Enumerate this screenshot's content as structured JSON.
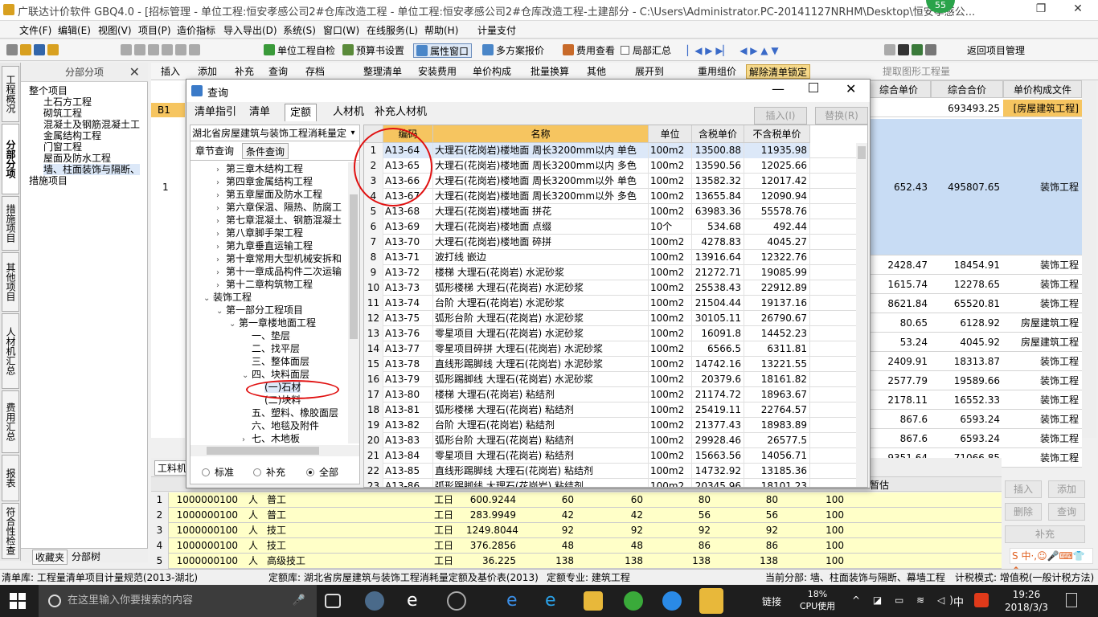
{
  "titlebar": {
    "title": "广联达计价软件 GBQ4.0 - [招标管理 - 单位工程:恒安孝感公司2#仓库改造工程 - 单位工程:恒安孝感公司2#仓库改造工程-土建部分 - C:\\Users\\Administrator.PC-20141127NRHM\\Desktop\\恒安孝感公...",
    "badge": "55",
    "restore": "❐",
    "close": "✕"
  },
  "menu": {
    "items": [
      "文件(F)",
      "编辑(E)",
      "视图(V)",
      "项目(P)",
      "造价指标",
      "导入导出(D)",
      "系统(S)",
      "窗口(W)",
      "在线服务(L)",
      "帮助(H)",
      "计量支付"
    ]
  },
  "toolbar1": {
    "unit_check": "单位工程自检",
    "budget_settings": "预算书设置",
    "attr_window": "属性窗口",
    "multi_quote": "多方案报价",
    "fee_view": "费用查看",
    "partial_summary": "局部汇总",
    "return_project": "返回项目管理"
  },
  "toolbar2": {
    "items": [
      "插入",
      "添加",
      "补充",
      "查询",
      "存档",
      "整理清单",
      "安装费用",
      "单价构成",
      "批量换算",
      "其他",
      "展开到",
      "重用组价",
      "解除清单锁定",
      "提取图形工程量"
    ]
  },
  "vtabs": [
    "工程概况",
    "分部分项",
    "措施项目",
    "其他项目",
    "人材机汇总",
    "费用汇总",
    "报表",
    "符合性检查"
  ],
  "leftpanel": {
    "header": "分部分项",
    "close": "✕",
    "items": [
      "整个项目",
      "土石方工程",
      "砌筑工程",
      "混凝土及钢筋混凝土工",
      "金属结构工程",
      "门窗工程",
      "屋面及防水工程",
      "墙、柱面装饰与隔断、",
      "措施项目"
    ],
    "bottom_tabs": [
      "收藏夹",
      "分部树"
    ]
  },
  "main_grid": {
    "headers": [
      "综合单价",
      "综合合价",
      "单价构成文件"
    ],
    "b1": "B1",
    "row1_num": "1",
    "rows": [
      [
        "",
        "693493.25",
        "[房屋建筑工程]"
      ],
      [
        "652.43",
        "495807.65",
        "装饰工程"
      ],
      [
        "2428.47",
        "18454.91",
        "装饰工程"
      ],
      [
        "1615.74",
        "12278.65",
        "装饰工程"
      ],
      [
        "8621.84",
        "65520.81",
        "装饰工程"
      ],
      [
        "80.65",
        "6128.92",
        "房屋建筑工程"
      ],
      [
        "53.24",
        "4045.92",
        "房屋建筑工程"
      ],
      [
        "2409.91",
        "18313.87",
        "装饰工程"
      ],
      [
        "2577.79",
        "19589.66",
        "装饰工程"
      ],
      [
        "2178.11",
        "16552.33",
        "装饰工程"
      ],
      [
        "867.6",
        "6593.24",
        "装饰工程"
      ],
      [
        "867.6",
        "6593.24",
        "装饰工程"
      ],
      [
        "9351.64",
        "71066.85",
        "装饰工程"
      ]
    ]
  },
  "bottom_grid": {
    "tab": "工料机",
    "temp_label": "暂估",
    "rows": [
      [
        "1",
        "1000000100",
        "人",
        "普工",
        "工日",
        "600.9244",
        "60",
        "60",
        "80",
        "80",
        "100"
      ],
      [
        "2",
        "1000000100",
        "人",
        "普工",
        "工日",
        "283.9949",
        "42",
        "42",
        "56",
        "56",
        "100"
      ],
      [
        "3",
        "1000000100",
        "人",
        "技工",
        "工日",
        "1249.8044",
        "92",
        "92",
        "92",
        "92",
        "100"
      ],
      [
        "4",
        "1000000100",
        "人",
        "技工",
        "工日",
        "376.2856",
        "48",
        "48",
        "86",
        "86",
        "100"
      ],
      [
        "5",
        "1000000100",
        "人",
        "高级技工",
        "工日",
        "36.225",
        "138",
        "138",
        "138",
        "138",
        "100"
      ]
    ],
    "buttons": [
      "插入",
      "添加",
      "删除",
      "查询",
      "补充"
    ]
  },
  "dialog": {
    "title": "查询",
    "tabs": [
      "清单指引",
      "清单",
      "定额",
      "人材机",
      "补充人材机"
    ],
    "insert": "插入(I)",
    "replace": "替换(R)",
    "quota_lib": "湖北省房屋建筑与装饰工程消耗量定",
    "subtabs": [
      "章节查询",
      "条件查询"
    ],
    "tree": [
      {
        "t": "第三章木结构工程",
        "l": 1,
        "a": "›"
      },
      {
        "t": "第四章金属结构工程",
        "l": 1,
        "a": "›"
      },
      {
        "t": "第五章屋面及防水工程",
        "l": 1,
        "a": "›"
      },
      {
        "t": "第六章保温、隔热、防腐工",
        "l": 1,
        "a": "›"
      },
      {
        "t": "第七章混凝土、钢筋混凝土",
        "l": 1,
        "a": "›"
      },
      {
        "t": "第八章脚手架工程",
        "l": 1,
        "a": "›"
      },
      {
        "t": "第九章垂直运输工程",
        "l": 1,
        "a": "›"
      },
      {
        "t": "第十章常用大型机械安拆和",
        "l": 1,
        "a": "›"
      },
      {
        "t": "第十一章成品构件二次运输",
        "l": 1,
        "a": "›"
      },
      {
        "t": "第十二章构筑物工程",
        "l": 1,
        "a": "›"
      },
      {
        "t": "装饰工程",
        "l": 0,
        "a": "⌄"
      },
      {
        "t": "第一部分工程项目",
        "l": 1,
        "a": "⌄"
      },
      {
        "t": "第一章楼地面工程",
        "l": 2,
        "a": "⌄"
      },
      {
        "t": "一、垫层",
        "l": 3,
        "a": ""
      },
      {
        "t": "二、找平层",
        "l": 3,
        "a": ""
      },
      {
        "t": "三、整体面层",
        "l": 3,
        "a": ""
      },
      {
        "t": "四、块料面层",
        "l": 3,
        "a": "⌄"
      },
      {
        "t": "(一)石材",
        "l": 4,
        "a": ""
      },
      {
        "t": "(二)块料",
        "l": 4,
        "a": ""
      },
      {
        "t": "五、塑料、橡胶面层",
        "l": 3,
        "a": ""
      },
      {
        "t": "六、地毯及附件",
        "l": 3,
        "a": ""
      },
      {
        "t": "七、木地板",
        "l": 3,
        "a": "›"
      }
    ],
    "radios": [
      "标准",
      "补充",
      "全部"
    ],
    "columns": [
      "编码",
      "名称",
      "单位",
      "含税单价",
      "不含税单价"
    ],
    "rows": [
      [
        "1",
        "A13-64",
        "大理石(花岗岩)楼地面 周长3200mm以内 单色",
        "100m2",
        "13500.88",
        "11935.98"
      ],
      [
        "2",
        "A13-65",
        "大理石(花岗岩)楼地面 周长3200mm以内 多色",
        "100m2",
        "13590.56",
        "12025.66"
      ],
      [
        "3",
        "A13-66",
        "大理石(花岗岩)楼地面 周长3200mm以外 单色",
        "100m2",
        "13582.32",
        "12017.42"
      ],
      [
        "4",
        "A13-67",
        "大理石(花岗岩)楼地面 周长3200mm以外 多色",
        "100m2",
        "13655.84",
        "12090.94"
      ],
      [
        "5",
        "A13-68",
        "大理石(花岗岩)楼地面 拼花",
        "100m2",
        "63983.36",
        "55578.76"
      ],
      [
        "6",
        "A13-69",
        "大理石(花岗岩)楼地面 点缀",
        "10个",
        "534.68",
        "492.44"
      ],
      [
        "7",
        "A13-70",
        "大理石(花岗岩)楼地面 碎拼",
        "100m2",
        "4278.83",
        "4045.27"
      ],
      [
        "8",
        "A13-71",
        "波打线 嵌边",
        "100m2",
        "13916.64",
        "12322.76"
      ],
      [
        "9",
        "A13-72",
        "楼梯 大理石(花岗岩) 水泥砂浆",
        "100m2",
        "21272.71",
        "19085.99"
      ],
      [
        "10",
        "A13-73",
        "弧形楼梯 大理石(花岗岩) 水泥砂浆",
        "100m2",
        "25538.43",
        "22912.89"
      ],
      [
        "11",
        "A13-74",
        "台阶 大理石(花岗岩) 水泥砂浆",
        "100m2",
        "21504.44",
        "19137.16"
      ],
      [
        "12",
        "A13-75",
        "弧形台阶 大理石(花岗岩) 水泥砂浆",
        "100m2",
        "30105.11",
        "26790.67"
      ],
      [
        "13",
        "A13-76",
        "零星项目 大理石(花岗岩) 水泥砂浆",
        "100m2",
        "16091.8",
        "14452.23"
      ],
      [
        "14",
        "A13-77",
        "零星项目碎拼 大理石(花岗岩) 水泥砂浆",
        "100m2",
        "6566.5",
        "6311.81"
      ],
      [
        "15",
        "A13-78",
        "直线形踢脚线 大理石(花岗岩) 水泥砂浆",
        "100m2",
        "14742.16",
        "13221.55"
      ],
      [
        "16",
        "A13-79",
        "弧形踢脚线 大理石(花岗岩) 水泥砂浆",
        "100m2",
        "20379.6",
        "18161.82"
      ],
      [
        "17",
        "A13-80",
        "楼梯 大理石(花岗岩) 粘结剂",
        "100m2",
        "21174.72",
        "18963.67"
      ],
      [
        "18",
        "A13-81",
        "弧形楼梯 大理石(花岗岩) 粘结剂",
        "100m2",
        "25419.11",
        "22764.57"
      ],
      [
        "19",
        "A13-82",
        "台阶 大理石(花岗岩) 粘结剂",
        "100m2",
        "21377.43",
        "18983.89"
      ],
      [
        "20",
        "A13-83",
        "弧形台阶 大理石(花岗岩) 粘结剂",
        "100m2",
        "29928.46",
        "26577.5"
      ],
      [
        "21",
        "A13-84",
        "零星项目 大理石(花岗岩) 粘结剂",
        "100m2",
        "15663.56",
        "14056.71"
      ],
      [
        "22",
        "A13-85",
        "直线形踢脚线 大理石(花岗岩) 粘结剂",
        "100m2",
        "14732.92",
        "13185.36"
      ],
      [
        "23",
        "A13-86",
        "弧形踢脚线 大理石(花岗岩) 粘结剂",
        "100m2",
        "20345.96",
        "18101.23"
      ]
    ]
  },
  "status": {
    "list_lib": "清单库: 工程量清单项目计量规范(2013-湖北)",
    "quota_lib": "定额库: 湖北省房屋建筑与装饰工程消耗量定额及基价表(2013)",
    "quota_major": "定额专业: 建筑工程",
    "current": "当前分部: 墙、柱面装饰与隔断、幕墙工程",
    "tax_mode": "计税模式: 增值税(一般计税方法)"
  },
  "taskbar": {
    "search_placeholder": "在这里输入你要搜索的内容",
    "link": "链接",
    "cpu_pct": "18%",
    "cpu_label": "CPU使用",
    "ime": "中",
    "time": "19:26",
    "date": "2018/3/3"
  },
  "colors": {
    "accent": "#f6c560",
    "circle": "#e01010",
    "row_yellow": "#ffffc8",
    "selection": "#dce8f8"
  }
}
